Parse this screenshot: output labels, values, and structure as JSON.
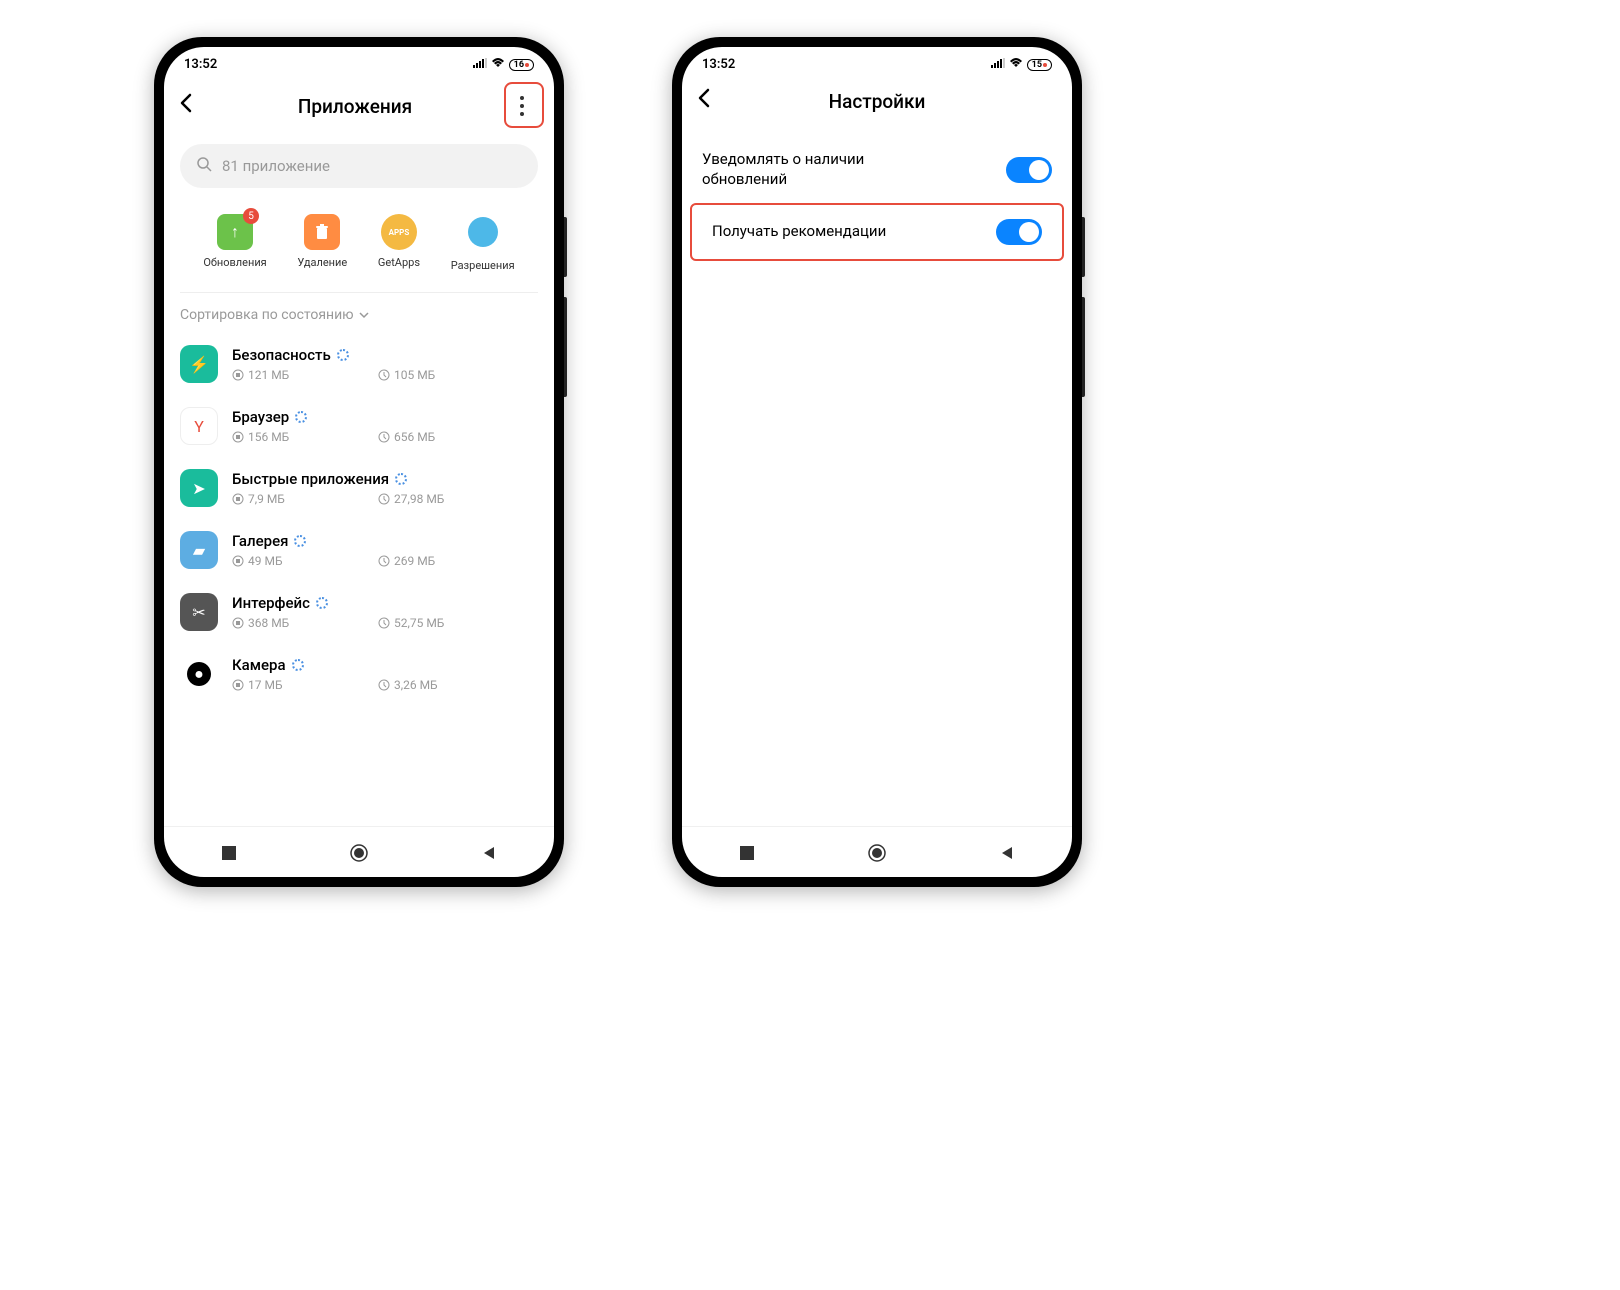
{
  "status": {
    "time": "13:52",
    "battery_left": "16",
    "battery_right": "15"
  },
  "left": {
    "title": "Приложения",
    "search_placeholder": "81 приложение",
    "actions": [
      {
        "label": "Обновления",
        "badge": "5"
      },
      {
        "label": "Удаление"
      },
      {
        "label": "GetApps",
        "text": "APPS"
      },
      {
        "label": "Разрешения"
      }
    ],
    "sort": "Сортировка по состоянию",
    "apps": [
      {
        "name": "Безопасность",
        "storage": "121 МБ",
        "time": "105 МБ",
        "icon_bg": "#1abc9c",
        "icon_glyph": "⚡"
      },
      {
        "name": "Браузер",
        "storage": "156 МБ",
        "time": "656 МБ",
        "icon_bg": "#ffffff",
        "icon_glyph": "Y",
        "icon_color": "#e74c3c"
      },
      {
        "name": "Быстрые приложения",
        "storage": "7,9 МБ",
        "time": "27,98 МБ",
        "icon_bg": "#1abc9c",
        "icon_glyph": "➤"
      },
      {
        "name": "Галерея",
        "storage": "49 МБ",
        "time": "269 МБ",
        "icon_bg": "#5dade2",
        "icon_glyph": "▰"
      },
      {
        "name": "Интерфейс",
        "storage": "368 МБ",
        "time": "52,75 МБ",
        "icon_bg": "#555",
        "icon_glyph": "✂"
      },
      {
        "name": "Камера",
        "storage": "17 МБ",
        "time": "3,26 МБ",
        "icon_bg": "#000",
        "icon_glyph": "●",
        "round": true
      }
    ]
  },
  "right": {
    "title": "Настройки",
    "settings": [
      {
        "label": "Уведомлять о наличии обновлений",
        "on": true
      },
      {
        "label": "Получать рекомендации",
        "on": true,
        "highlight": true
      }
    ]
  }
}
